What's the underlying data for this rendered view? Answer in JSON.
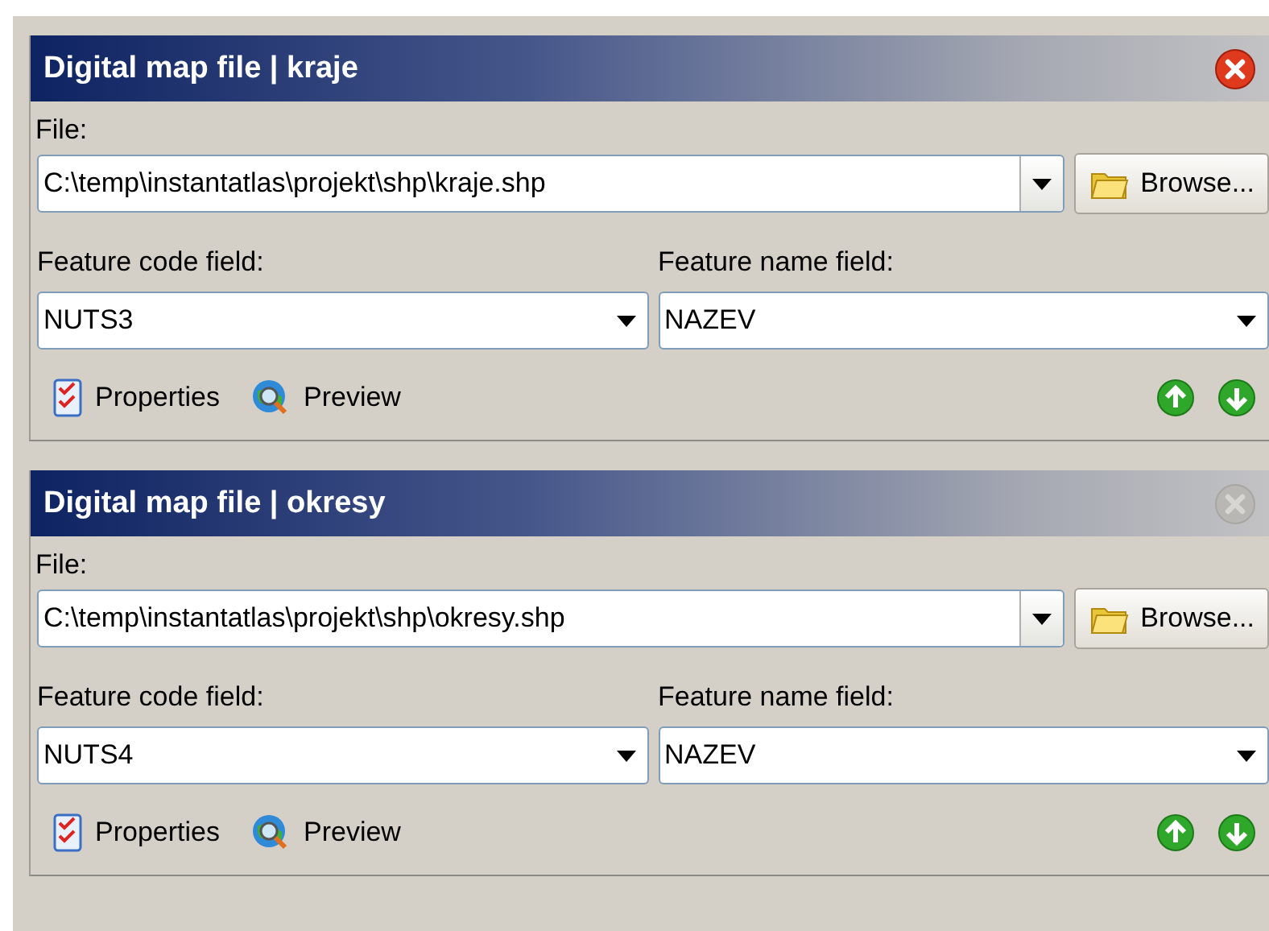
{
  "panels": [
    {
      "title": "Digital map file | kraje",
      "close_enabled": true,
      "file_label": "File:",
      "file_path": "C:\\temp\\instantatlas\\projekt\\shp\\kraje.shp",
      "browse": "Browse...",
      "code_label": "Feature code field:",
      "code_value": "NUTS3",
      "name_label": "Feature name field:",
      "name_value": "NAZEV",
      "properties": "Properties",
      "preview": "Preview"
    },
    {
      "title": "Digital map file | okresy",
      "close_enabled": false,
      "file_label": "File:",
      "file_path": "C:\\temp\\instantatlas\\projekt\\shp\\okresy.shp",
      "browse": "Browse...",
      "code_label": "Feature code field:",
      "code_value": "NUTS4",
      "name_label": "Feature name field:",
      "name_value": "NAZEV",
      "properties": "Properties",
      "preview": "Preview"
    }
  ]
}
